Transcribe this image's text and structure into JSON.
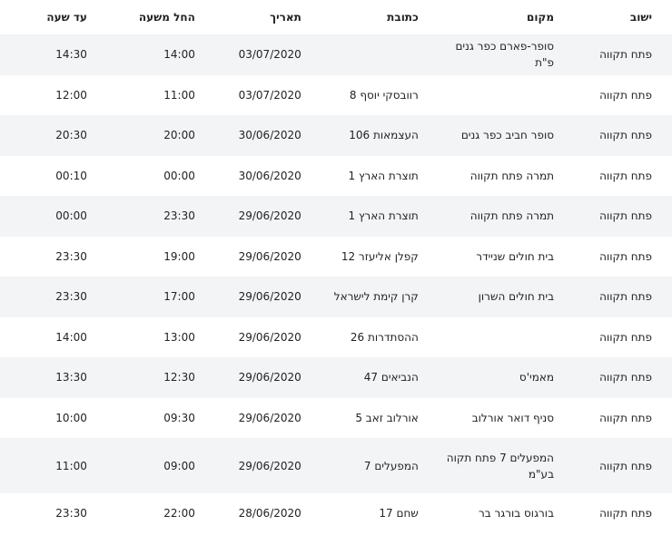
{
  "table": {
    "headers": {
      "city": "ישוב",
      "place": "מקום",
      "address": "כתובת",
      "date": "תאריך",
      "from": "החל משעה",
      "to": "עד שעה"
    },
    "rows": [
      {
        "city": "פתח תקווה",
        "place": "סופר-פארם כפר גנים פ\"ת",
        "address": "",
        "date": "03/07/2020",
        "from": "14:00",
        "to": "14:30"
      },
      {
        "city": "פתח תקווה",
        "place": "",
        "address": "רוובסקי יוסף 8",
        "date": "03/07/2020",
        "from": "11:00",
        "to": "12:00"
      },
      {
        "city": "פתח תקווה",
        "place": "סופר חביב כפר גנים",
        "address": "העצמאות 106",
        "date": "30/06/2020",
        "from": "20:00",
        "to": "20:30"
      },
      {
        "city": "פתח תקווה",
        "place": "תמרה פתח תקווה",
        "address": "תוצרת הארץ 1",
        "date": "30/06/2020",
        "from": "00:00",
        "to": "00:10"
      },
      {
        "city": "פתח תקווה",
        "place": "תמרה פתח תקווה",
        "address": "תוצרת הארץ 1",
        "date": "29/06/2020",
        "from": "23:30",
        "to": "00:00"
      },
      {
        "city": "פתח תקווה",
        "place": "בית חולים שניידר",
        "address": "קפלן אליעזר 12",
        "date": "29/06/2020",
        "from": "19:00",
        "to": "23:30"
      },
      {
        "city": "פתח תקווה",
        "place": "בית חולים השרון",
        "address": "קרן קימת לישראל",
        "date": "29/06/2020",
        "from": "17:00",
        "to": "23:30"
      },
      {
        "city": "פתח תקווה",
        "place": "",
        "address": "ההסתדרות 26",
        "date": "29/06/2020",
        "from": "13:00",
        "to": "14:00"
      },
      {
        "city": "פתח תקווה",
        "place": "מאמי'ס",
        "address": "הנביאים 47",
        "date": "29/06/2020",
        "from": "12:30",
        "to": "13:30"
      },
      {
        "city": "פתח תקווה",
        "place": "סניף דואר אורלוב",
        "address": "אורלוב זאב 5",
        "date": "29/06/2020",
        "from": "09:30",
        "to": "10:00"
      },
      {
        "city": "פתח תקווה",
        "place": "המפעלים 7 פתח תקוה בע\"מ",
        "address": "המפעלים 7",
        "date": "29/06/2020",
        "from": "09:00",
        "to": "11:00"
      },
      {
        "city": "פתח תקווה",
        "place": "בורגוס בורגר בר",
        "address": "שחם 17",
        "date": "28/06/2020",
        "from": "22:00",
        "to": "23:30"
      }
    ]
  }
}
